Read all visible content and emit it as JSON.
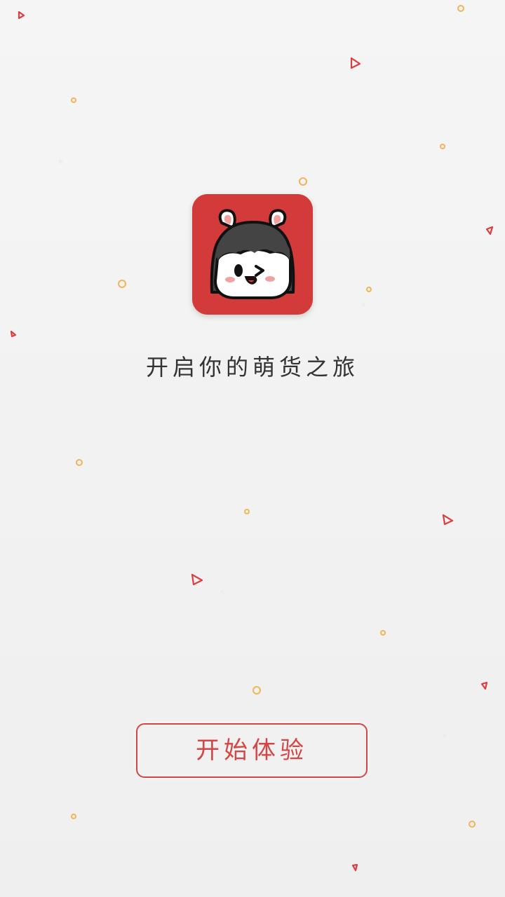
{
  "screen": {
    "background": "#f1f1f1",
    "accent": "#d64545",
    "decoration_colors": {
      "triangle": "#dd3d3d",
      "circle": "#f3b457"
    }
  },
  "logo": {
    "name": "app-logo",
    "character": "bunny-girl-icon"
  },
  "tagline": "开启你的萌货之旅",
  "button": {
    "label": "开始体验"
  }
}
